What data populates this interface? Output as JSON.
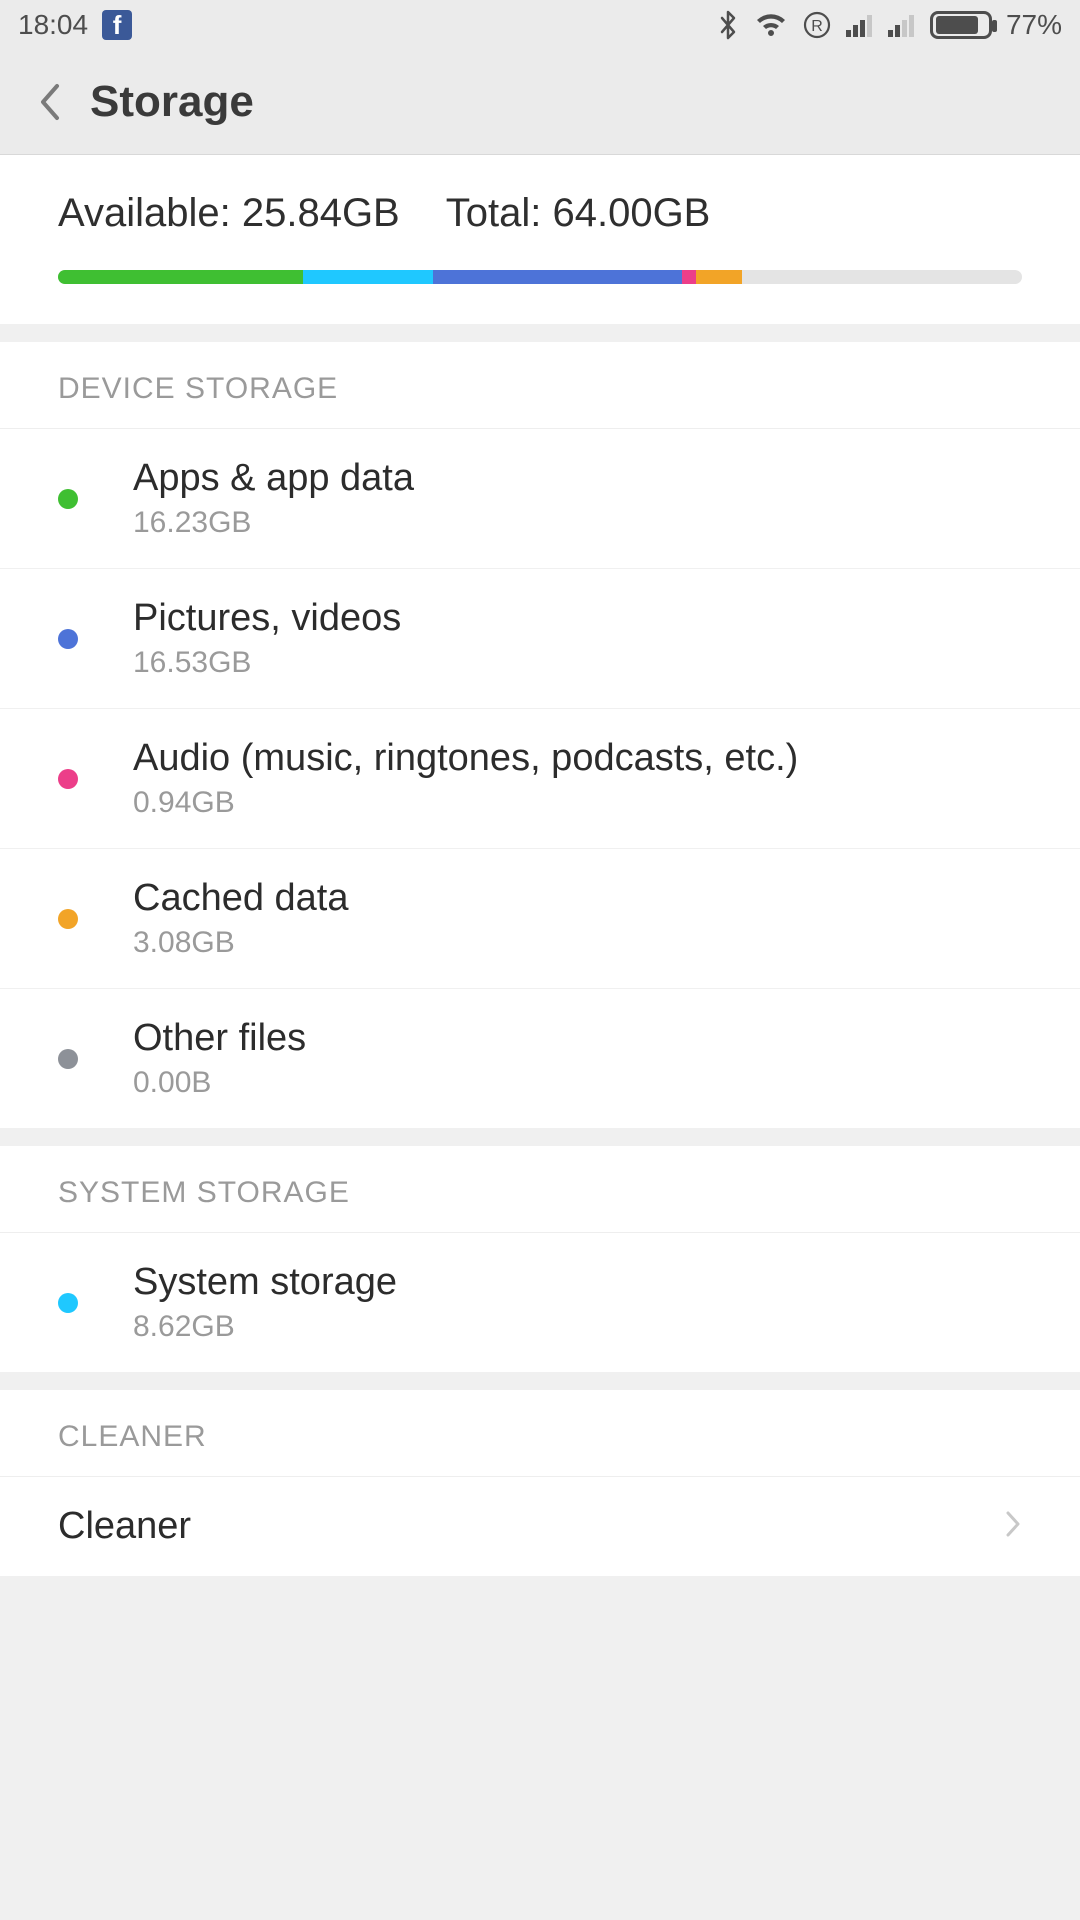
{
  "status": {
    "time": "18:04",
    "battery_percent": "77%",
    "battery_fill_pct": 77
  },
  "header": {
    "title": "Storage"
  },
  "summary": {
    "available_label": "Available:",
    "available_value": "25.84GB",
    "total_label": "Total:",
    "total_value": "64.00GB",
    "bar": [
      {
        "color": "c-green",
        "pct": 25.4
      },
      {
        "color": "c-cyan",
        "pct": 13.5
      },
      {
        "color": "c-blue",
        "pct": 25.8
      },
      {
        "color": "c-pink",
        "pct": 1.5
      },
      {
        "color": "c-orange",
        "pct": 4.8
      }
    ]
  },
  "sections": {
    "device": {
      "header": "DEVICE STORAGE",
      "items": [
        {
          "dot": "c-green",
          "title": "Apps & app data",
          "sub": "16.23GB"
        },
        {
          "dot": "c-blue",
          "title": "Pictures, videos",
          "sub": "16.53GB"
        },
        {
          "dot": "c-pink",
          "title": "Audio (music, ringtones, podcasts, etc.)",
          "sub": "0.94GB"
        },
        {
          "dot": "c-orange",
          "title": "Cached data",
          "sub": "3.08GB"
        },
        {
          "dot": "c-gray",
          "title": "Other files",
          "sub": "0.00B"
        }
      ]
    },
    "system": {
      "header": "SYSTEM STORAGE",
      "items": [
        {
          "dot": "c-cyan",
          "title": "System storage",
          "sub": "8.62GB"
        }
      ]
    },
    "cleaner": {
      "header": "CLEANER",
      "items": [
        {
          "title": "Cleaner"
        }
      ]
    }
  }
}
